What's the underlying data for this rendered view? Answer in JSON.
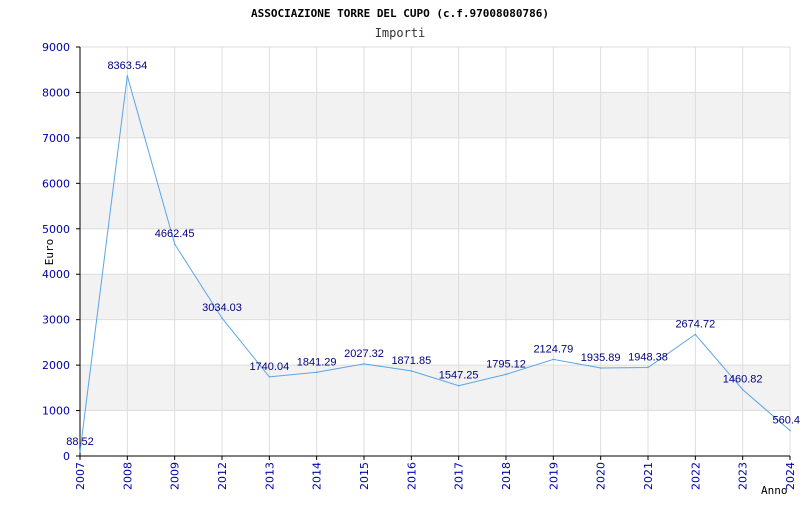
{
  "chart_data": {
    "type": "line",
    "title": "ASSOCIAZIONE TORRE DEL CUPO (c.f.97008080786)",
    "subtitle": "Importi",
    "ylabel": "Euro",
    "xlabel": "Anno",
    "ylim": [
      0,
      9000
    ],
    "yticks": [
      "0",
      "1000",
      "2000",
      "3000",
      "4000",
      "5000",
      "6000",
      "7000",
      "8000",
      "9000"
    ],
    "categories": [
      "2007",
      "2008",
      "2009",
      "2012",
      "2013",
      "2014",
      "2015",
      "2016",
      "2017",
      "2018",
      "2019",
      "2020",
      "2021",
      "2022",
      "2023",
      "2024"
    ],
    "values": [
      88.52,
      8363.54,
      4662.45,
      3034.03,
      1740.04,
      1841.29,
      2027.32,
      1871.85,
      1547.25,
      1795.12,
      2124.79,
      1935.89,
      1948.38,
      2674.72,
      1460.82,
      560.4
    ],
    "value_labels": [
      "88.52",
      "8363.54",
      "4662.45",
      "3034.03",
      "1740.04",
      "1841.29",
      "2027.32",
      "1871.85",
      "1547.25",
      "1795.12",
      "2124.79",
      "1935.89",
      "1948.38",
      "2674.72",
      "1460.82",
      "560.4"
    ],
    "grid": true,
    "band_color": "#f2f2f2",
    "grid_color": "#dddddd",
    "line_color": "#5aa5e6",
    "tick_color": "#0000aa",
    "label_color": "#000080"
  }
}
